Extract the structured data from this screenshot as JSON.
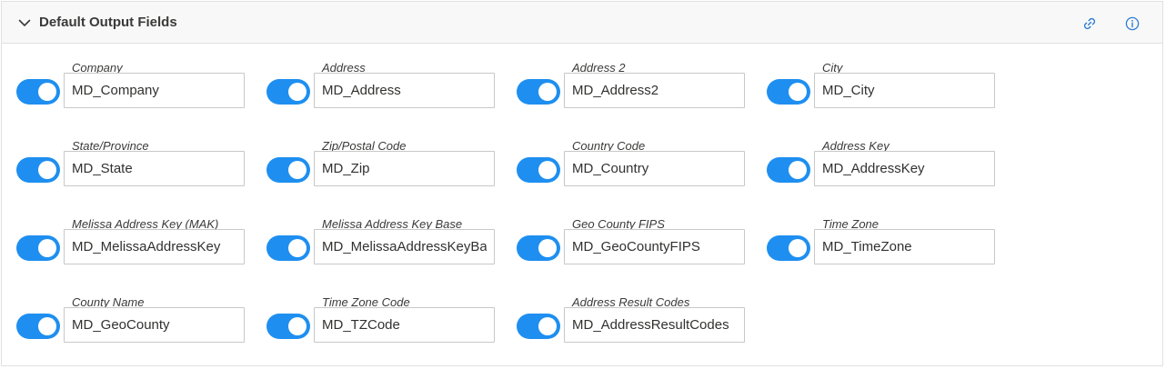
{
  "panel": {
    "title": "Default Output Fields",
    "icons": {
      "collapse": "chevron-down-icon",
      "link": "link-icon",
      "info": "info-icon"
    }
  },
  "colors": {
    "toggle_on": "#1e8ff0",
    "header_bg": "#f8f8f8",
    "icon_blue": "#2b7cd3"
  },
  "fields": [
    {
      "label": "Company",
      "value": "MD_Company",
      "enabled": true
    },
    {
      "label": "Address",
      "value": "MD_Address",
      "enabled": true
    },
    {
      "label": "Address 2",
      "value": "MD_Address2",
      "enabled": true
    },
    {
      "label": "City",
      "value": "MD_City",
      "enabled": true
    },
    {
      "label": "State/Province",
      "value": "MD_State",
      "enabled": true
    },
    {
      "label": "Zip/Postal Code",
      "value": "MD_Zip",
      "enabled": true
    },
    {
      "label": "Country Code",
      "value": "MD_Country",
      "enabled": true
    },
    {
      "label": "Address Key",
      "value": "MD_AddressKey",
      "enabled": true
    },
    {
      "label": "Melissa Address Key (MAK)",
      "value": "MD_MelissaAddressKey",
      "enabled": true
    },
    {
      "label": "Melissa Address Key Base",
      "value": "MD_MelissaAddressKeyBase",
      "enabled": true
    },
    {
      "label": "Geo County FIPS",
      "value": "MD_GeoCountyFIPS",
      "enabled": true
    },
    {
      "label": "Time Zone",
      "value": "MD_TimeZone",
      "enabled": true
    },
    {
      "label": "County Name",
      "value": "MD_GeoCounty",
      "enabled": true
    },
    {
      "label": "Time Zone Code",
      "value": "MD_TZCode",
      "enabled": true
    },
    {
      "label": "Address Result Codes",
      "value": "MD_AddressResultCodes",
      "enabled": true
    }
  ]
}
